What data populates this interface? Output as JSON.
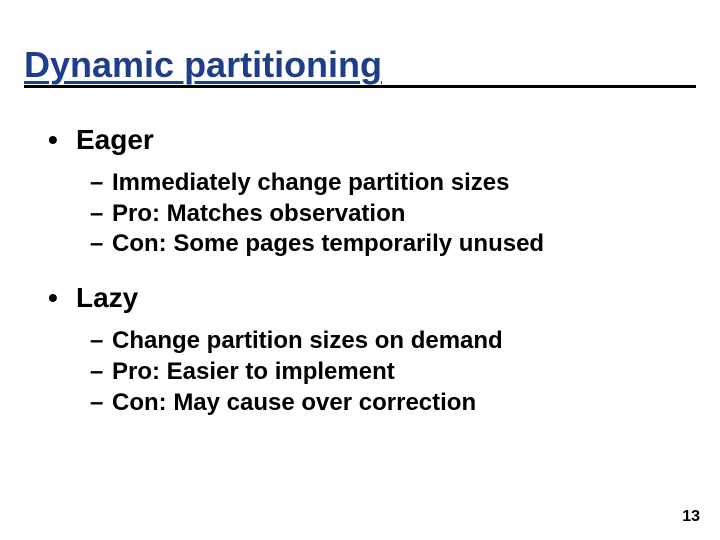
{
  "slide": {
    "title": "Dynamic partitioning",
    "page_number": "13",
    "items": [
      {
        "label": "Eager",
        "sub": [
          "Immediately change partition sizes",
          "Pro: Matches observation",
          "Con: Some pages temporarily unused"
        ]
      },
      {
        "label": "Lazy",
        "sub": [
          "Change partition sizes on demand",
          "Pro: Easier to implement",
          "Con: May cause over correction"
        ]
      }
    ]
  }
}
